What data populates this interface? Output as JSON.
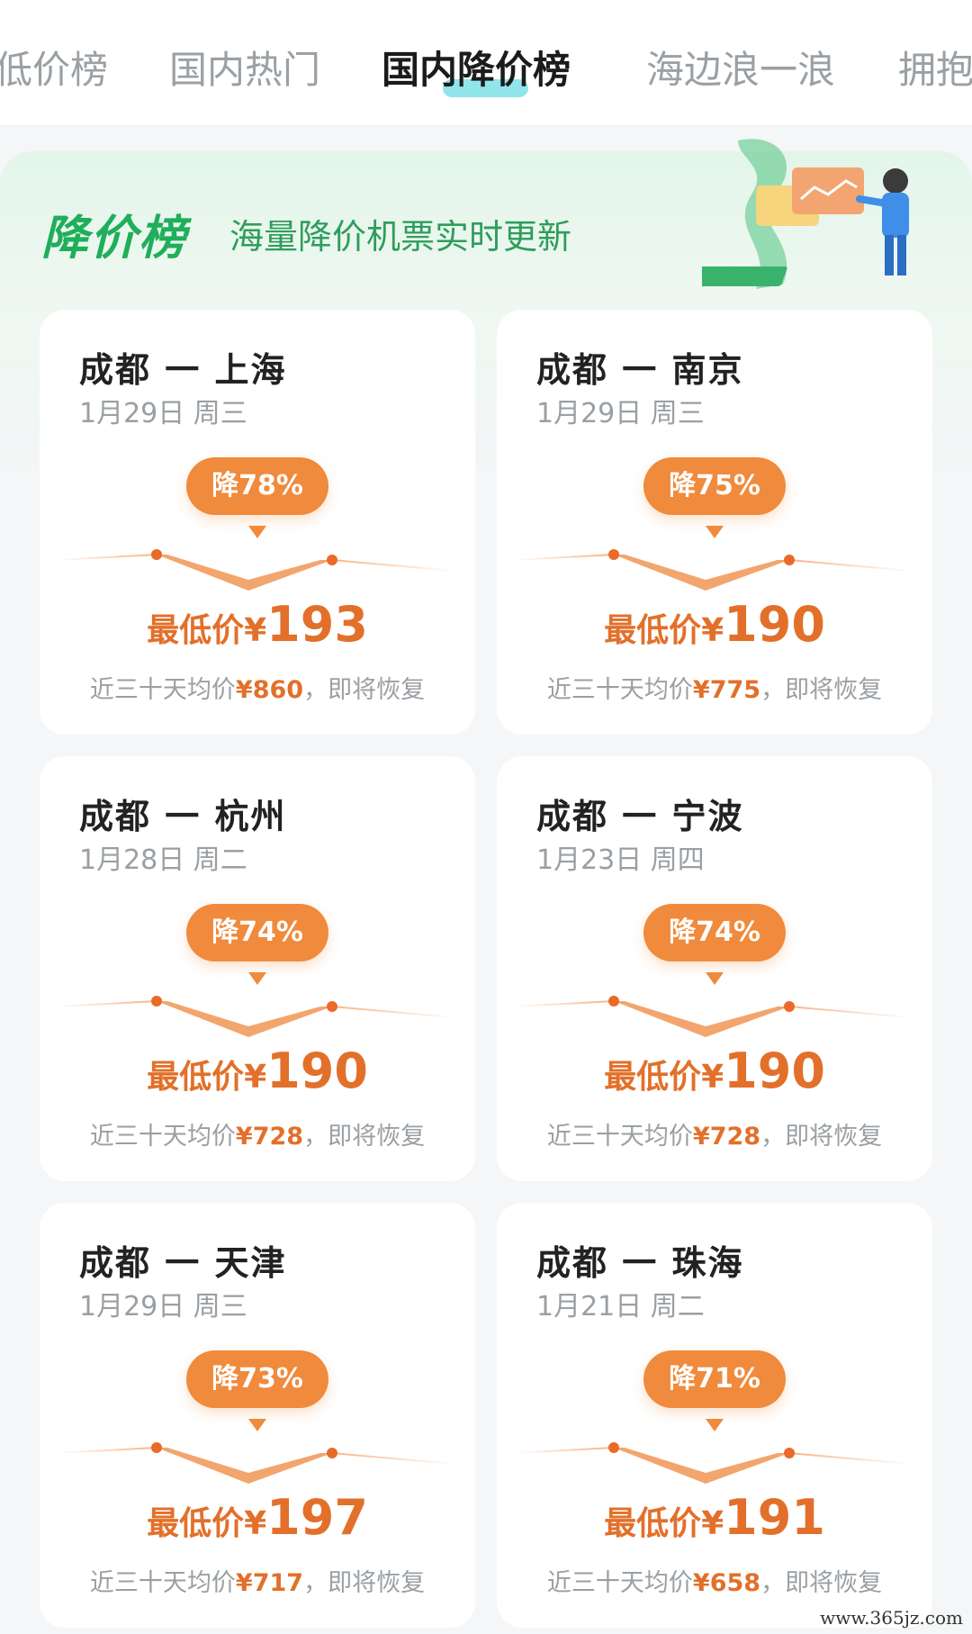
{
  "tabs": [
    {
      "label": "低价榜"
    },
    {
      "label": "国内热门"
    },
    {
      "label": "国内降价榜"
    },
    {
      "label": "海边浪一浪"
    },
    {
      "label": "拥抱"
    }
  ],
  "banner": {
    "title": "降价榜",
    "subtitle": "海量降价机票实时更新"
  },
  "cards": [
    {
      "route": "成都 一 上海",
      "date": "1月29日 周三",
      "drop": "降78%",
      "lowest_label": "最低价",
      "currency": "¥",
      "lowest": "193",
      "avg_prefix": "近三十天均价",
      "avg": "¥860",
      "avg_suffix": "，即将恢复"
    },
    {
      "route": "成都 一 南京",
      "date": "1月29日 周三",
      "drop": "降75%",
      "lowest_label": "最低价",
      "currency": "¥",
      "lowest": "190",
      "avg_prefix": "近三十天均价",
      "avg": "¥775",
      "avg_suffix": "，即将恢复"
    },
    {
      "route": "成都 一 杭州",
      "date": "1月28日 周二",
      "drop": "降74%",
      "lowest_label": "最低价",
      "currency": "¥",
      "lowest": "190",
      "avg_prefix": "近三十天均价",
      "avg": "¥728",
      "avg_suffix": "，即将恢复"
    },
    {
      "route": "成都 一 宁波",
      "date": "1月23日 周四",
      "drop": "降74%",
      "lowest_label": "最低价",
      "currency": "¥",
      "lowest": "190",
      "avg_prefix": "近三十天均价",
      "avg": "¥728",
      "avg_suffix": "，即将恢复"
    },
    {
      "route": "成都 一 天津",
      "date": "1月29日 周三",
      "drop": "降73%",
      "lowest_label": "最低价",
      "currency": "¥",
      "lowest": "197",
      "avg_prefix": "近三十天均价",
      "avg": "¥717",
      "avg_suffix": "，即将恢复"
    },
    {
      "route": "成都 一 珠海",
      "date": "1月21日 周二",
      "drop": "降71%",
      "lowest_label": "最低价",
      "currency": "¥",
      "lowest": "191",
      "avg_prefix": "近三十天均价",
      "avg": "¥658",
      "avg_suffix": "，即将恢复"
    }
  ],
  "watermark": "www.365jz.com",
  "colors": {
    "accent": "#f08a3c",
    "price": "#e2702a",
    "brand_green": "#1fae5a",
    "tab_underline": "#7fe0e6"
  }
}
